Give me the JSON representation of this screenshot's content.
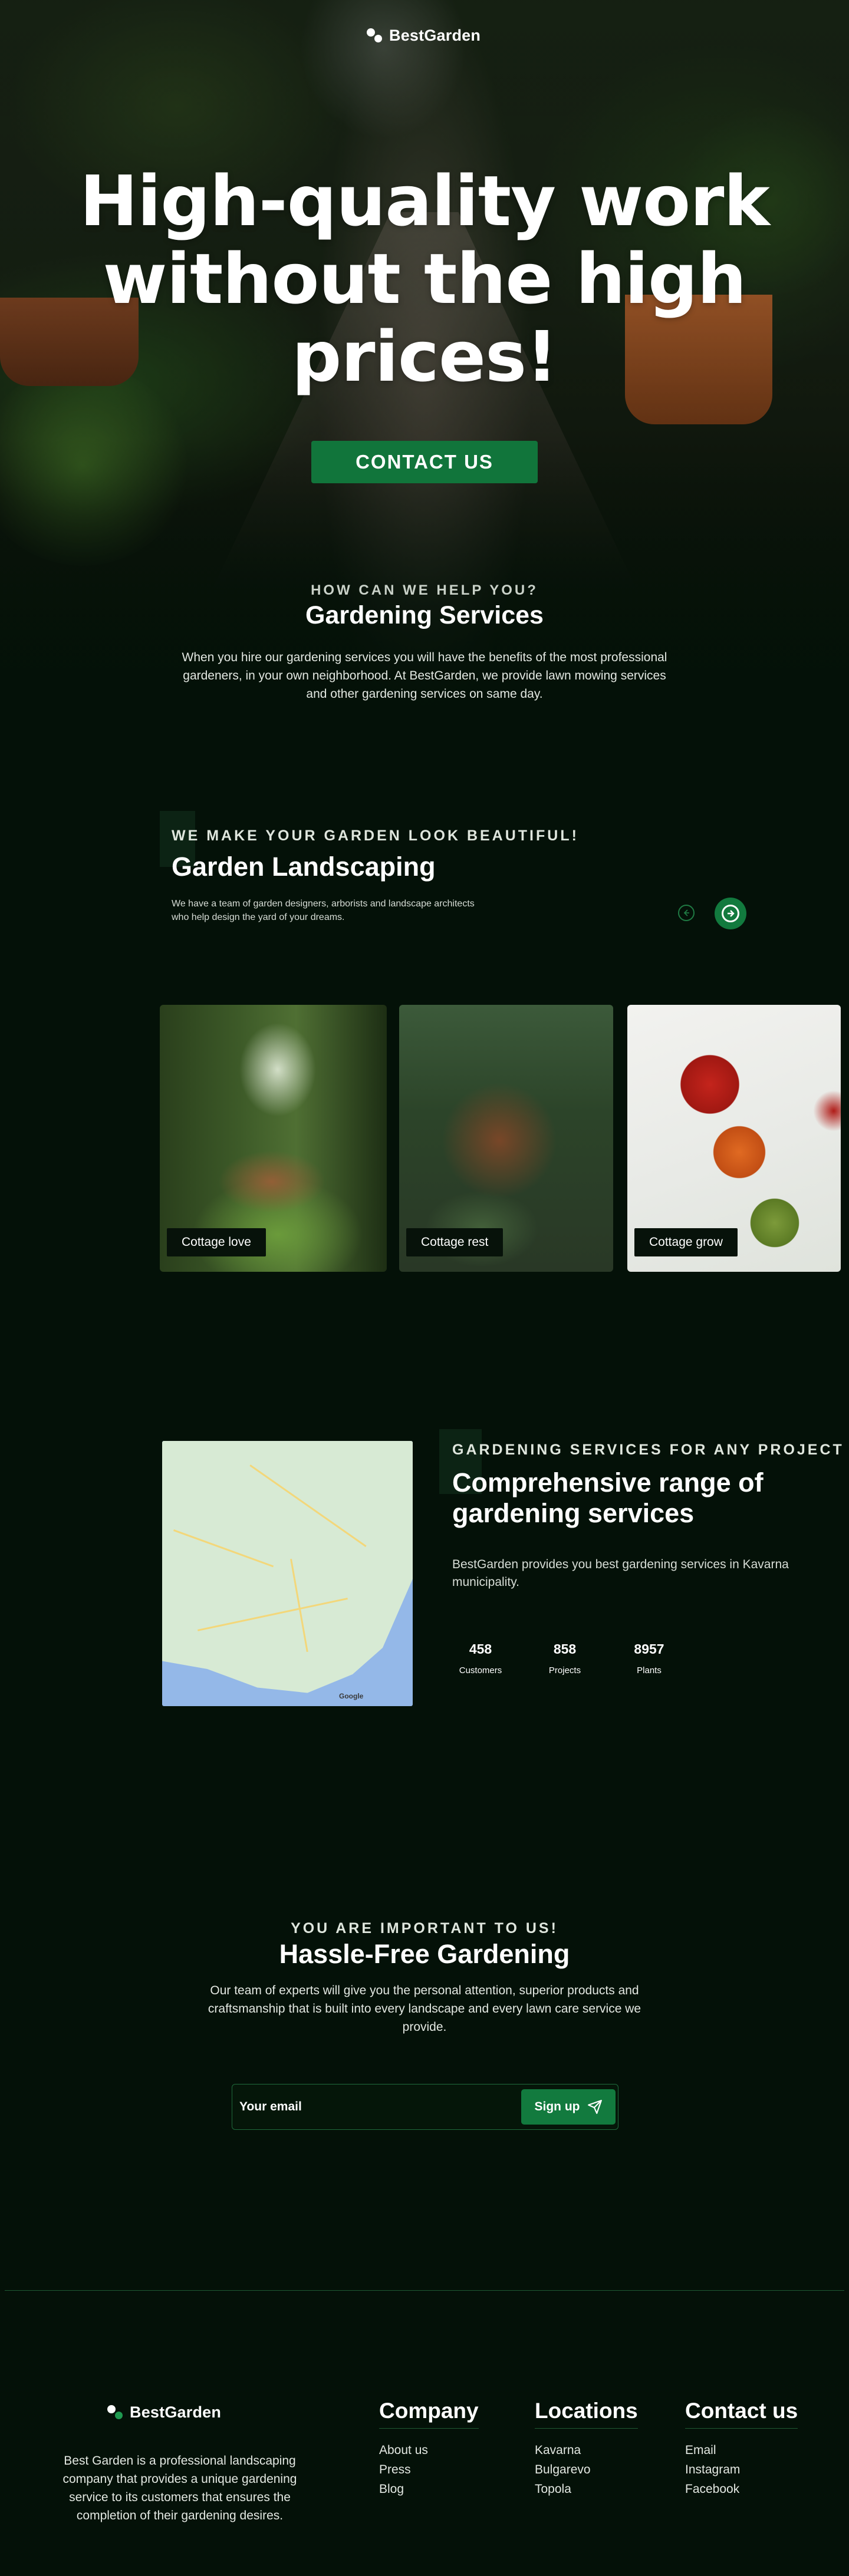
{
  "brand": {
    "name": "BestGarden",
    "accent": "#127a3e"
  },
  "hero": {
    "title": "High-quality work without the high prices!",
    "cta_label": "CONTACT US"
  },
  "help": {
    "eyebrow": "HOW CAN WE HELP YOU?",
    "title": "Gardening Services",
    "text": "When you hire our gardening services you will have the benefits of the most professional gardeners, in your own neighborhood. At BestGarden, we provide lawn mowing services and other gardening services on same day."
  },
  "landscaping": {
    "eyebrow": "WE MAKE YOUR GARDEN LOOK BEAUTIFUL!",
    "title": "Garden Landscaping",
    "text": "We have a team of garden designers, arborists and landscape architects who help design the yard of your dreams.",
    "prev_icon": "arrow-left-icon",
    "next_icon": "arrow-right-icon",
    "cards": [
      {
        "label": "Cottage love"
      },
      {
        "label": "Cottage rest"
      },
      {
        "label": "Cottage grow"
      }
    ]
  },
  "services": {
    "eyebrow": "GARDENING SERVICES FOR ANY PROJECT",
    "title": "Comprehensive range of gardening services",
    "text": "BestGarden provides you best gardening services in Kavarna municipality.",
    "map_attribution": "Google",
    "stats": [
      {
        "value": "458",
        "label": "Customers"
      },
      {
        "value": "858",
        "label": "Projects"
      },
      {
        "value": "8957",
        "label": "Plants"
      }
    ]
  },
  "newsletter": {
    "eyebrow": "YOU ARE IMPORTANT TO US!",
    "title": "Hassle-Free Gardening",
    "text": "Our team of experts will give you the personal attention, superior products and craftsmanship that is built into every landscape and every lawn care service we provide.",
    "email_placeholder": "Your email",
    "signup_label": "Sign up",
    "signup_icon": "send-icon"
  },
  "footer": {
    "about": "Best Garden is a professional landscaping company that provides a unique gardening service to its customers that ensures the completion of their gardening desires.",
    "columns": [
      {
        "title": "Company",
        "links": [
          "About us",
          "Press",
          "Blog"
        ]
      },
      {
        "title": "Locations",
        "links": [
          "Kavarna",
          "Bulgarevo",
          "Topola"
        ]
      },
      {
        "title": "Contact us",
        "links": [
          "Email",
          "Instagram",
          "Facebook"
        ]
      }
    ]
  }
}
